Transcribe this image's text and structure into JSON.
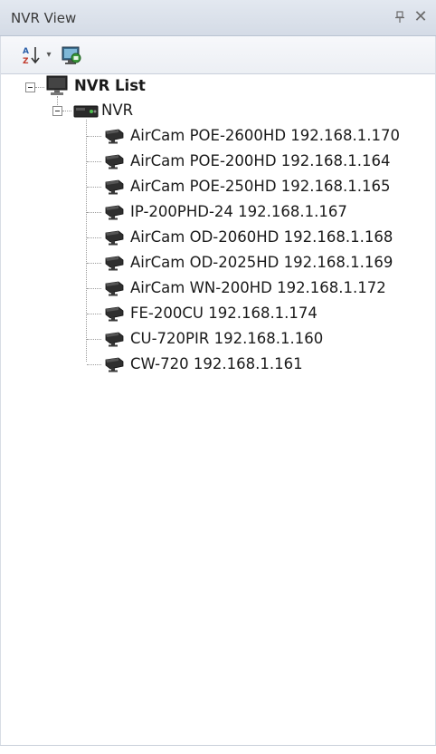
{
  "panel": {
    "title": "NVR View",
    "pin_symbol": "ꟸ",
    "close_symbol": "✕"
  },
  "toolbar": {
    "sort_icon": "sort-az-icon",
    "dropdown_symbol": "▾",
    "refresh_icon": "network-refresh-icon"
  },
  "tree": {
    "root": {
      "label": "NVR List",
      "icon": "monitor-icon"
    },
    "nvr": {
      "label": "NVR",
      "icon": "nvr-device-icon"
    },
    "cameras": [
      {
        "label": "AirCam POE-2600HD 192.168.1.170",
        "icon": "camera-icon"
      },
      {
        "label": "AirCam POE-200HD 192.168.1.164",
        "icon": "camera-icon"
      },
      {
        "label": "AirCam POE-250HD 192.168.1.165",
        "icon": "camera-icon"
      },
      {
        "label": "IP-200PHD-24 192.168.1.167",
        "icon": "camera-icon"
      },
      {
        "label": "AirCam OD-2060HD 192.168.1.168",
        "icon": "camera-icon"
      },
      {
        "label": "AirCam OD-2025HD 192.168.1.169",
        "icon": "camera-icon"
      },
      {
        "label": "AirCam WN-200HD 192.168.1.172",
        "icon": "camera-icon"
      },
      {
        "label": "FE-200CU 192.168.1.174",
        "icon": "camera-icon"
      },
      {
        "label": "CU-720PIR 192.168.1.160",
        "icon": "camera-icon"
      },
      {
        "label": "CW-720 192.168.1.161",
        "icon": "camera-icon"
      }
    ]
  }
}
